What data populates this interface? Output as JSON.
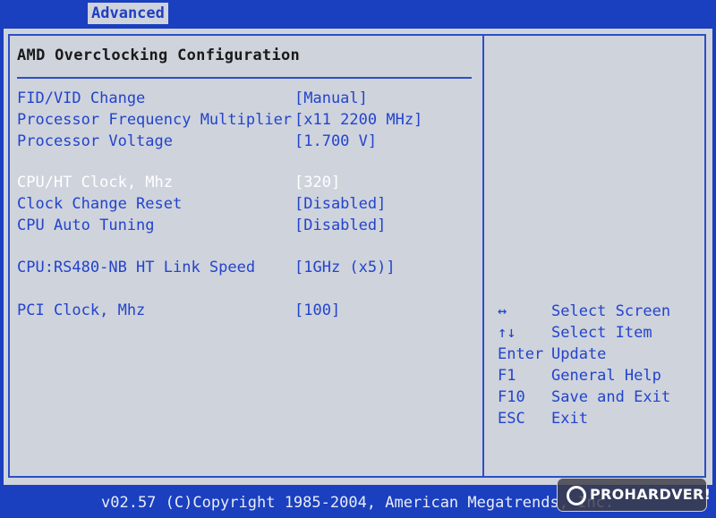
{
  "topbar": {
    "active_tab": "Advanced"
  },
  "panel": {
    "title": "AMD Overclocking Configuration",
    "settings": [
      {
        "label": "FID/VID Change",
        "value": "[Manual]"
      },
      {
        "label": "Processor Frequency Multiplier",
        "value": "[x11 2200 MHz]"
      },
      {
        "label": "Processor Voltage",
        "value": "[1.700 V]"
      },
      {
        "label": "CPU/HT  Clock, Mhz",
        "value": "[320]"
      },
      {
        "label": "Clock Change Reset",
        "value": "[Disabled]"
      },
      {
        "label": "CPU Auto Tuning",
        "value": "[Disabled]"
      },
      {
        "label": "CPU:RS480-NB HT Link Speed",
        "value": "[1GHz   (x5)]"
      },
      {
        "label": "PCI Clock, Mhz",
        "value": "[100]"
      }
    ]
  },
  "help": [
    {
      "key": "↔",
      "desc": "Select Screen"
    },
    {
      "key": "↑↓",
      "desc": "Select Item"
    },
    {
      "key": "Enter",
      "desc": "Update"
    },
    {
      "key": "F1",
      "desc": "General Help"
    },
    {
      "key": "F10",
      "desc": "Save and Exit"
    },
    {
      "key": "ESC",
      "desc": "Exit"
    }
  ],
  "footer": {
    "copyright": "v02.57 (C)Copyright 1985-2004, American Megatrends, Inc."
  },
  "watermark": {
    "text": "PROHARDVER!"
  },
  "colors": {
    "background": "#1a3fbf",
    "panel": "#cfd3dc",
    "text_blue": "#2244cc",
    "selected": "#ffffff"
  }
}
